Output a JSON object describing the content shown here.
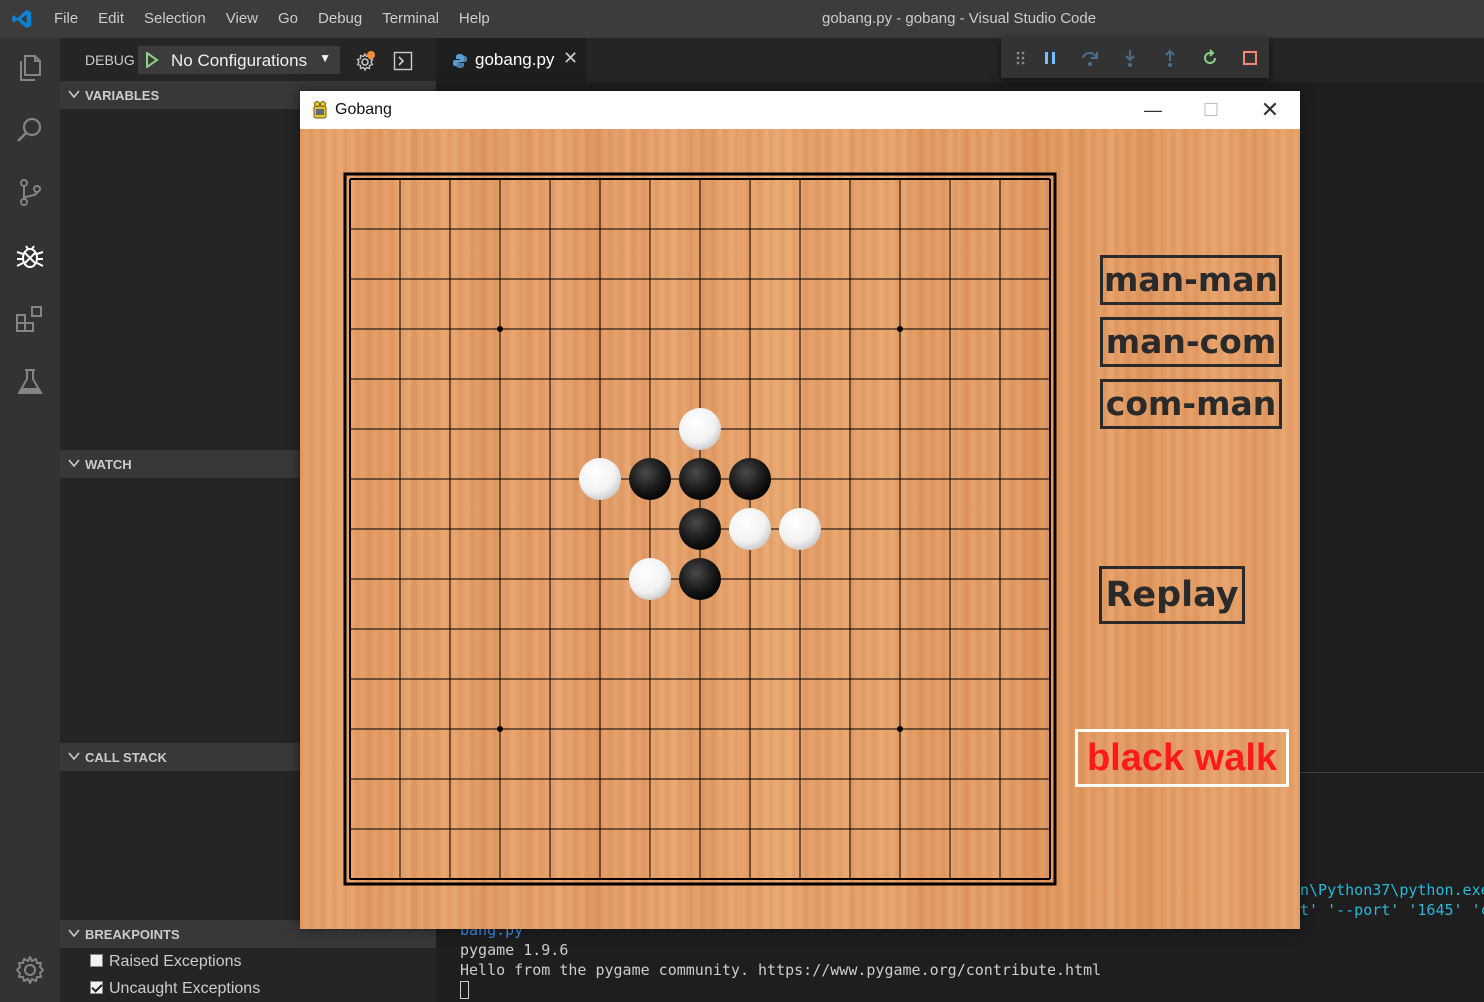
{
  "vscode": {
    "window_title": "gobang.py - gobang - Visual Studio Code",
    "menu": [
      "File",
      "Edit",
      "Selection",
      "View",
      "Go",
      "Debug",
      "Terminal",
      "Help"
    ],
    "activity_icons": [
      "explorer-icon",
      "search-icon",
      "source-control-icon",
      "debug-icon",
      "extensions-icon",
      "test-icon",
      "settings-gear-icon"
    ],
    "accent_color": "#007acc"
  },
  "debug": {
    "label": "DEBUG",
    "configuration": "No Configurations",
    "sections": {
      "variables": "VARIABLES",
      "watch": "WATCH",
      "call_stack": "CALL STACK",
      "breakpoints": "BREAKPOINTS"
    },
    "breakpoints": [
      {
        "label": "Raised Exceptions",
        "checked": false
      },
      {
        "label": "Uncaught Exceptions",
        "checked": true
      }
    ],
    "toolbar": [
      "drag-handle-icon",
      "pause-icon",
      "step-over-icon",
      "step-into-icon",
      "step-out-icon",
      "restart-icon",
      "stop-icon"
    ]
  },
  "editor": {
    "tab_name": "gobang.py"
  },
  "terminal": {
    "lines": [
      "bang.py",
      "pygame 1.9.6",
      "Hello from the pygame community. https://www.pygame.org/contribute.html"
    ],
    "right_lines": [
      "n\\Python37\\python.exe",
      "t' '--port' '1645' 'c"
    ]
  },
  "gobang": {
    "title": "Gobang",
    "buttons": {
      "man_man": "man-man",
      "man_com": "man-com",
      "com_man": "com-man",
      "replay": "Replay"
    },
    "status": "black walk",
    "status_color": "#ff1a1a",
    "board": {
      "size": 15,
      "star_points": [
        [
          3,
          3
        ],
        [
          3,
          11
        ],
        [
          11,
          3
        ],
        [
          11,
          11
        ]
      ],
      "stones": [
        {
          "row": 5,
          "col": 7,
          "color": "white"
        },
        {
          "row": 6,
          "col": 5,
          "color": "white"
        },
        {
          "row": 6,
          "col": 6,
          "color": "black"
        },
        {
          "row": 6,
          "col": 7,
          "color": "black"
        },
        {
          "row": 6,
          "col": 8,
          "color": "black"
        },
        {
          "row": 7,
          "col": 7,
          "color": "black"
        },
        {
          "row": 7,
          "col": 8,
          "color": "white"
        },
        {
          "row": 7,
          "col": 9,
          "color": "white"
        },
        {
          "row": 8,
          "col": 6,
          "color": "white"
        },
        {
          "row": 8,
          "col": 7,
          "color": "black"
        }
      ]
    }
  }
}
